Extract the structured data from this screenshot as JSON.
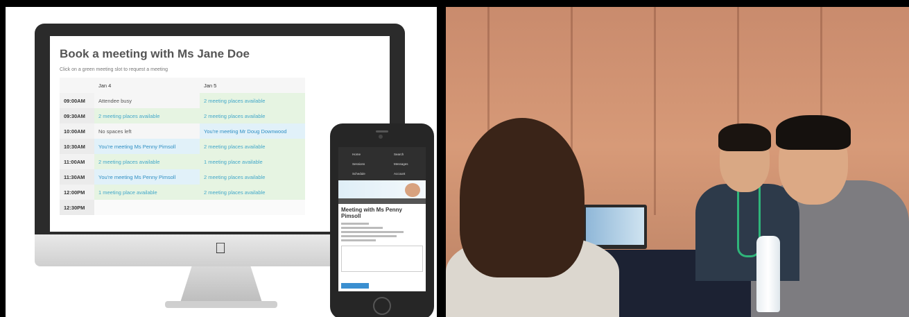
{
  "booking": {
    "title": "Book a meeting with Ms Jane Doe",
    "subtitle": "Click on a green meeting slot to request a meeting",
    "columns": [
      "Jan 4",
      "Jan 5"
    ],
    "rows": [
      {
        "time": "09:00AM",
        "jan4": "Attendee busy",
        "jan5": "2 meeting places available"
      },
      {
        "time": "09:30AM",
        "jan4": "2 meeting places available",
        "jan5": "2 meeting places available"
      },
      {
        "time": "10:00AM",
        "jan4": "No spaces left",
        "jan5": "You're meeting Mr Doug Downwood"
      },
      {
        "time": "10:30AM",
        "jan4": "You're meeting Ms Penny Pimsoll",
        "jan5": "2 meeting places available"
      },
      {
        "time": "11:00AM",
        "jan4": "2 meeting places available",
        "jan5": "1 meeting place available"
      },
      {
        "time": "11:30AM",
        "jan4": "You're meeting Ms Penny Pimsoll",
        "jan5": "2 meeting places available"
      },
      {
        "time": "12:00PM",
        "jan4": "1 meeting place available",
        "jan5": "2 meeting places available"
      },
      {
        "time": "12:30PM",
        "jan4": "",
        "jan5": ""
      }
    ]
  },
  "phone": {
    "nav": [
      "Home",
      "Search",
      "Sessions",
      "Messages",
      "Schedule",
      "Account"
    ],
    "meeting_title": "Meeting with Ms Penny Pimsoll"
  },
  "colors": {
    "available_bg": "#e6f4e2",
    "available_text": "#43a8c9",
    "meeting_bg": "#e1f1f9",
    "meeting_text": "#2f8fc4"
  }
}
